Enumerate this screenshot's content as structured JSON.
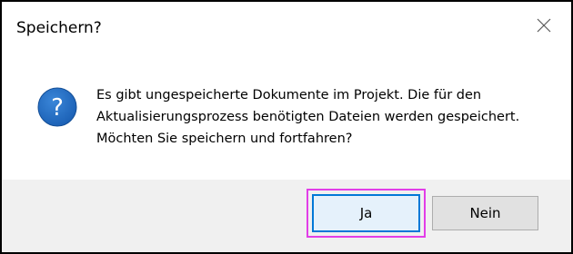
{
  "dialog": {
    "title": "Speichern?",
    "icon": "question-icon",
    "message_lines": [
      "Es gibt ungespeicherte Dokumente im Projekt. Die für den",
      "Aktualisierungsprozess benötigten Dateien werden gespeichert.",
      "Möchten Sie speichern und fortfahren?"
    ],
    "buttons": {
      "yes_label": "Ja",
      "no_label": "Nein"
    }
  },
  "colors": {
    "icon_blue": "#1a5fb4",
    "default_button_border": "#0078d7",
    "highlight": "#e23ee8",
    "footer_background": "#f0f0f0"
  }
}
